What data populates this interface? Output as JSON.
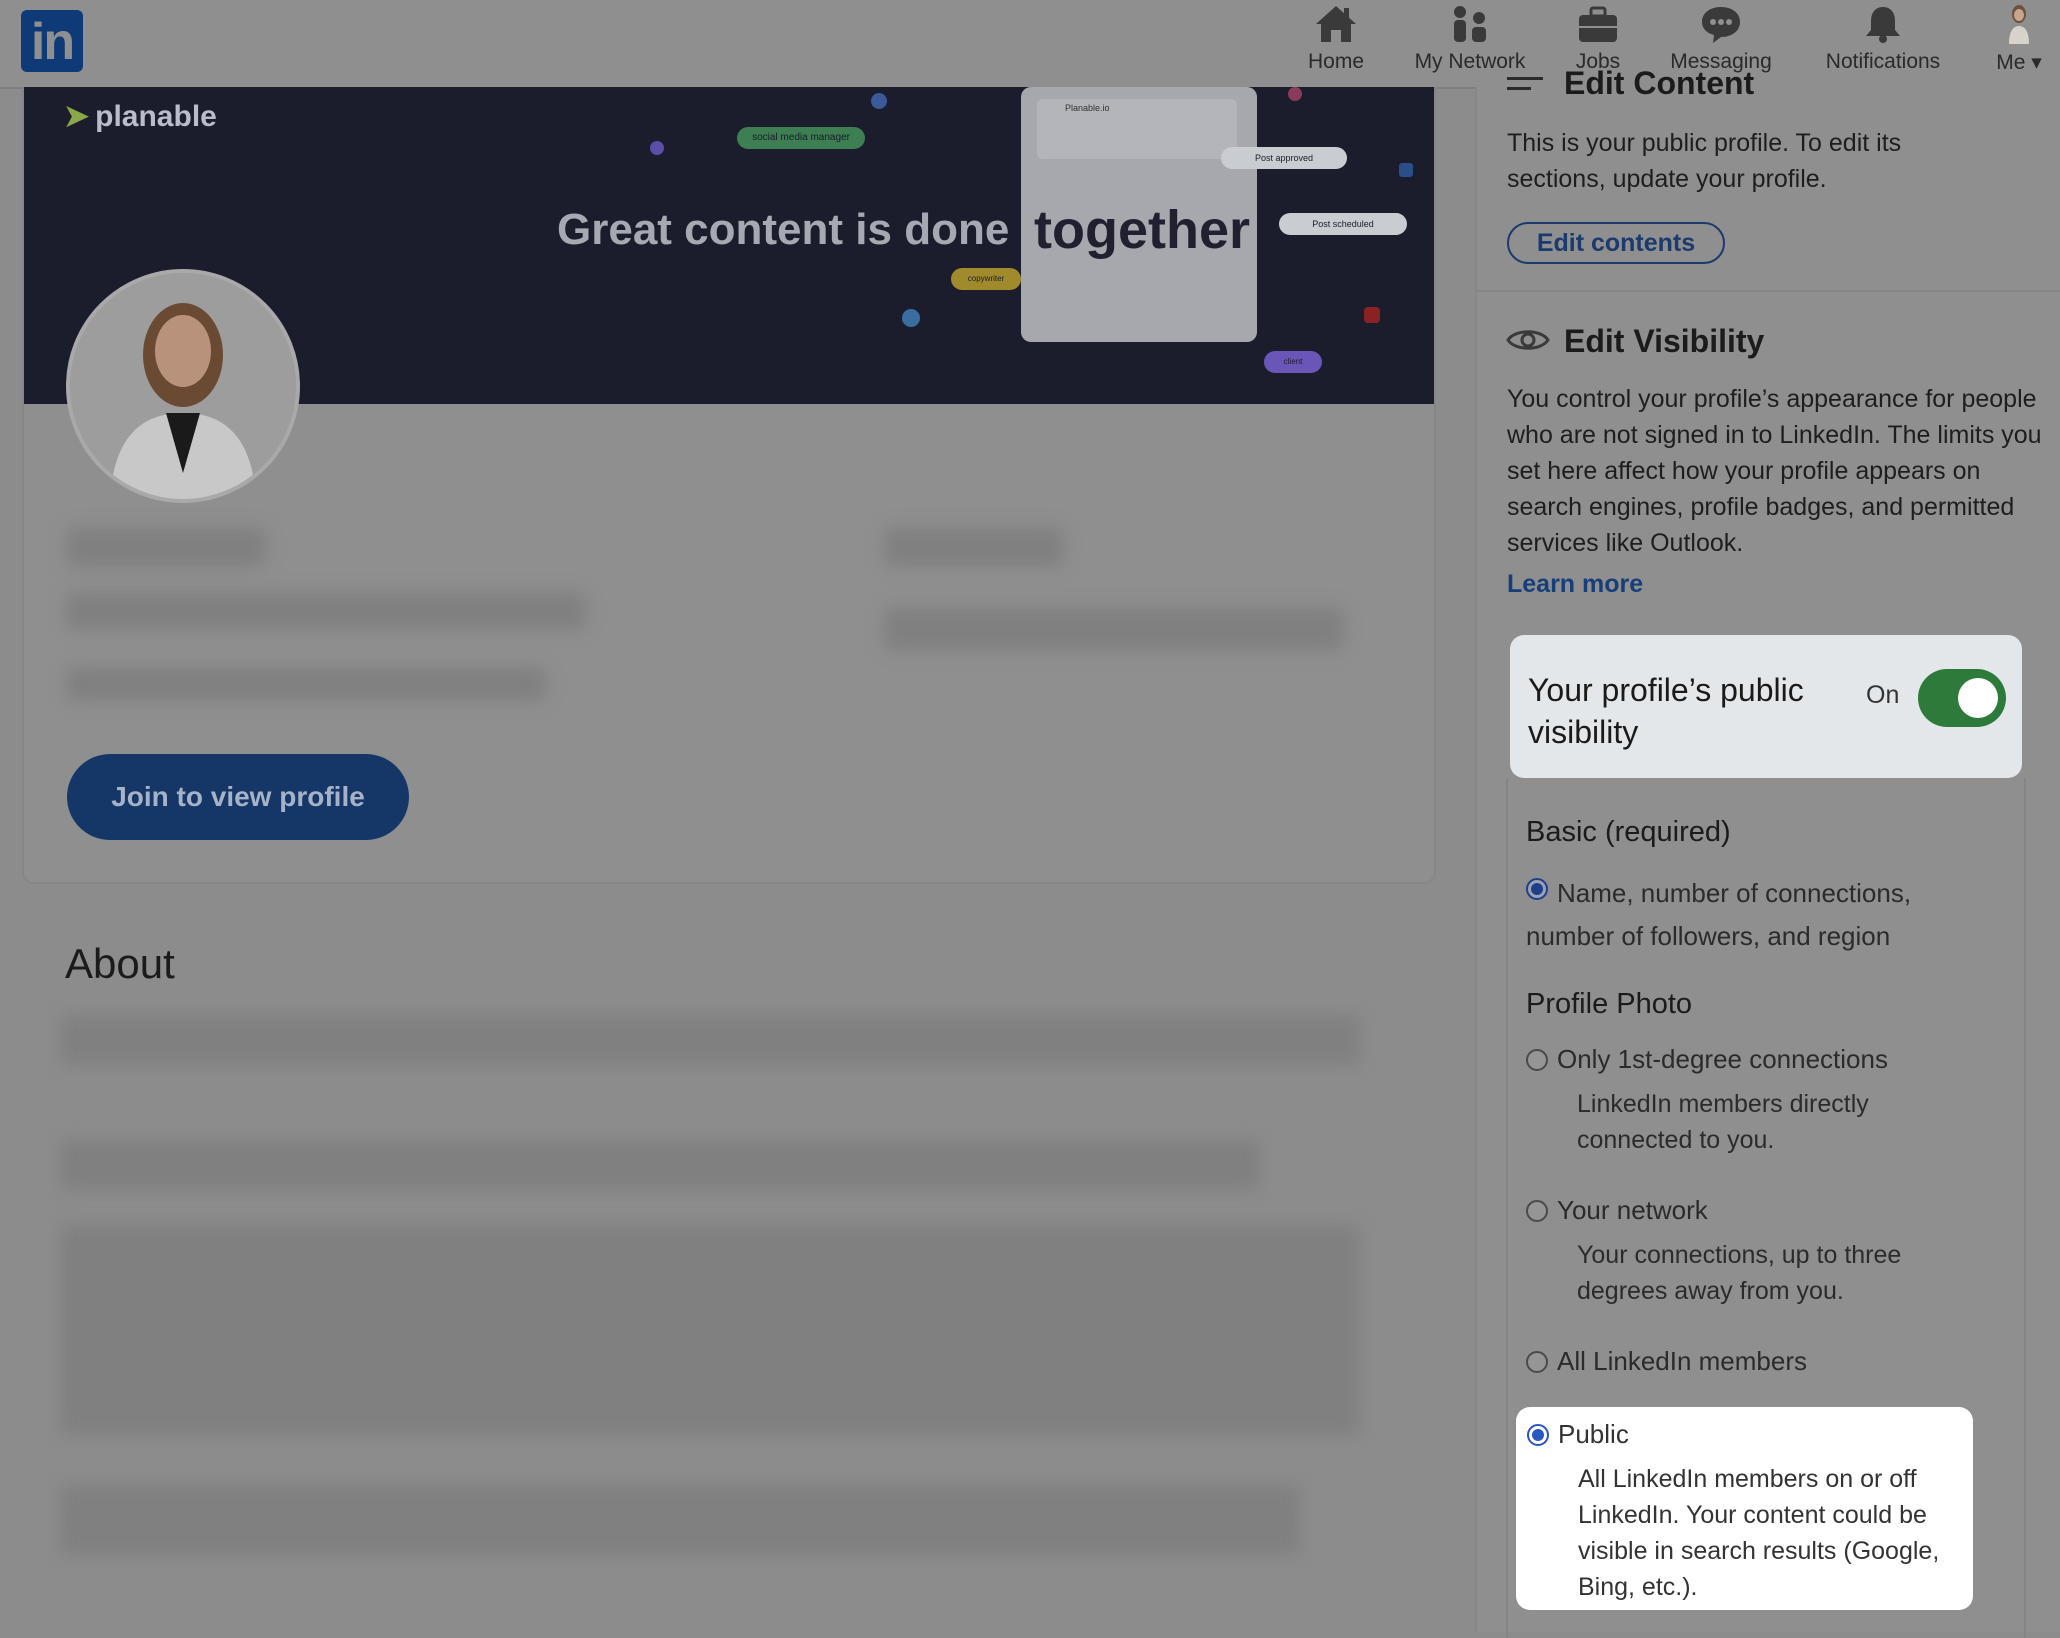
{
  "nav": {
    "logo_text": "in",
    "items": [
      {
        "label": "Home",
        "icon": "home-icon"
      },
      {
        "label": "My Network",
        "icon": "network-icon"
      },
      {
        "label": "Jobs",
        "icon": "briefcase-icon"
      },
      {
        "label": "Messaging",
        "icon": "messaging-icon"
      },
      {
        "label": "Notifications",
        "icon": "bell-icon"
      },
      {
        "label": "Me",
        "icon": "avatar-icon"
      }
    ]
  },
  "banner": {
    "brand": "planable",
    "headline": "Great content is done",
    "highlight": "together",
    "pills": [
      "social media manager",
      "Post approved",
      "Post scheduled",
      "copywriter",
      "client"
    ],
    "card_title": "Planable.io"
  },
  "profile": {
    "join_button": "Join to view profile",
    "about_title": "About"
  },
  "sidebar": {
    "edit_content_title": "Edit Content",
    "edit_content_desc": "This is your public profile. To edit its sections, update your profile.",
    "edit_contents_button": "Edit contents",
    "edit_visibility_title": "Edit Visibility",
    "edit_visibility_desc": "You control your profile’s appearance for people who are not signed in to LinkedIn. The limits you set here affect how your profile appears on search engines, profile badges, and permitted services like Outlook.",
    "learn_more": "Learn more",
    "public_visibility_label": "Your profile’s public visibility",
    "public_visibility_state": "On",
    "basic_heading": "Basic (required)",
    "basic_option": "Name, number of connections, number of followers, and region",
    "photo_heading": "Profile Photo",
    "photo_options": [
      {
        "label": "Only 1st-degree connections",
        "desc": "LinkedIn members directly connected to you.",
        "selected": false
      },
      {
        "label": "Your network",
        "desc": "Your connections, up to three degrees away from you.",
        "selected": false
      },
      {
        "label": "All LinkedIn members",
        "desc": "",
        "selected": false
      },
      {
        "label": "Public",
        "desc": "All LinkedIn members on or off LinkedIn. Your content could be visible in search results (Google, Bing, etc.).",
        "selected": true
      }
    ]
  },
  "colors": {
    "overlay": "#8f8f8f",
    "brand_blue": "#0a66c2",
    "toggle_on": "#2d7a3a",
    "radio_selected": "#2a56c0"
  }
}
